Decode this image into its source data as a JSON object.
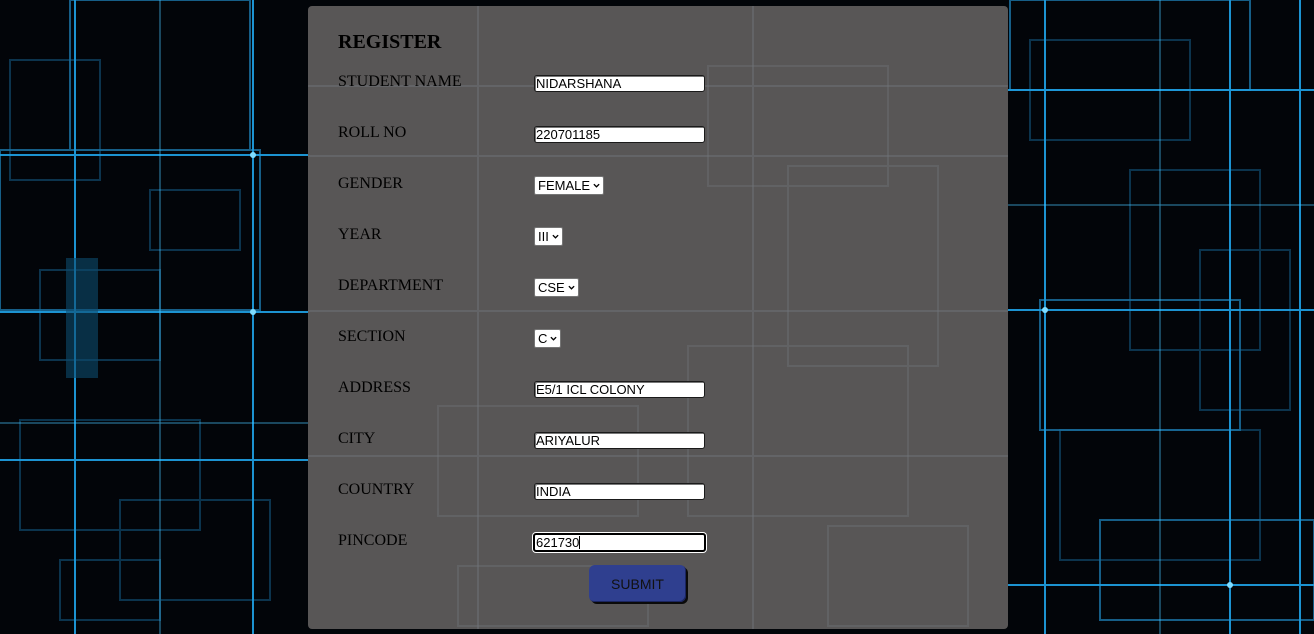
{
  "form": {
    "title": "REGISTER",
    "fields": {
      "student_name": {
        "label": "STUDENT NAME",
        "value": "NIDARSHANA"
      },
      "roll_no": {
        "label": "ROLL NO",
        "value": "220701185"
      },
      "gender": {
        "label": "GENDER",
        "selected": "FEMALE"
      },
      "year": {
        "label": "YEAR",
        "selected": "III"
      },
      "department": {
        "label": "DEPARTMENT",
        "selected": "CSE"
      },
      "section": {
        "label": "SECTION",
        "selected": "C"
      },
      "address": {
        "label": "ADDRESS",
        "value": "E5/1 ICL COLONY"
      },
      "city": {
        "label": "CITY",
        "value": "ARIYALUR"
      },
      "country": {
        "label": "COUNTRY",
        "value": "INDIA"
      },
      "pincode": {
        "label": "PINCODE",
        "value": "621730"
      }
    },
    "submit_label": "SUBMIT"
  },
  "icons": {
    "select_arrow": "chevron-down-icon"
  },
  "colors": {
    "panel": "#5c5a5a",
    "background": "#020509",
    "circuit_lines": "#1e9bdc",
    "submit_button": "#2f3f8f"
  }
}
